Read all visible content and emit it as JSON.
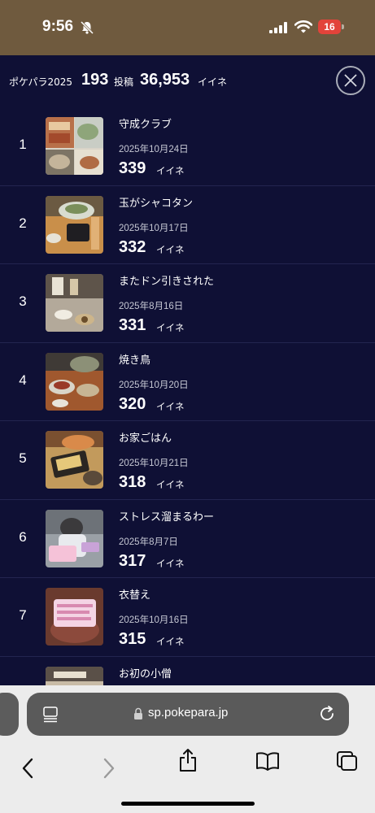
{
  "status_bar": {
    "time": "9:56",
    "battery": "16",
    "battery_color": "#e2433a"
  },
  "header": {
    "brand": "ポケパラ2025",
    "posts_count": "193",
    "posts_label": "投稿",
    "likes_count": "36,953",
    "likes_label": "イイネ"
  },
  "ranking": [
    {
      "rank": "1",
      "title": "守成クラブ",
      "date": "2025年10月24日",
      "likes": "339",
      "unit": "イイネ"
    },
    {
      "rank": "2",
      "title": "玉がシャコタン",
      "date": "2025年10月17日",
      "likes": "332",
      "unit": "イイネ"
    },
    {
      "rank": "3",
      "title": "またドン引きされた",
      "date": "2025年8月16日",
      "likes": "331",
      "unit": "イイネ"
    },
    {
      "rank": "4",
      "title": "焼き鳥",
      "date": "2025年10月20日",
      "likes": "320",
      "unit": "イイネ"
    },
    {
      "rank": "5",
      "title": "お家ごはん",
      "date": "2025年10月21日",
      "likes": "318",
      "unit": "イイネ"
    },
    {
      "rank": "6",
      "title": "ストレス溜まるわー",
      "date": "2025年8月7日",
      "likes": "317",
      "unit": "イイネ"
    },
    {
      "rank": "7",
      "title": "衣替え",
      "date": "2025年10月16日",
      "likes": "315",
      "unit": "イイネ"
    },
    {
      "rank": "",
      "title": "お初の小僧",
      "date": "",
      "likes": "",
      "unit": ""
    }
  ],
  "browser": {
    "url": "sp.pokepara.jp"
  },
  "colors": {
    "background": "#0f1035",
    "status_bar": "#6f5a3e",
    "divider": "#232550"
  }
}
